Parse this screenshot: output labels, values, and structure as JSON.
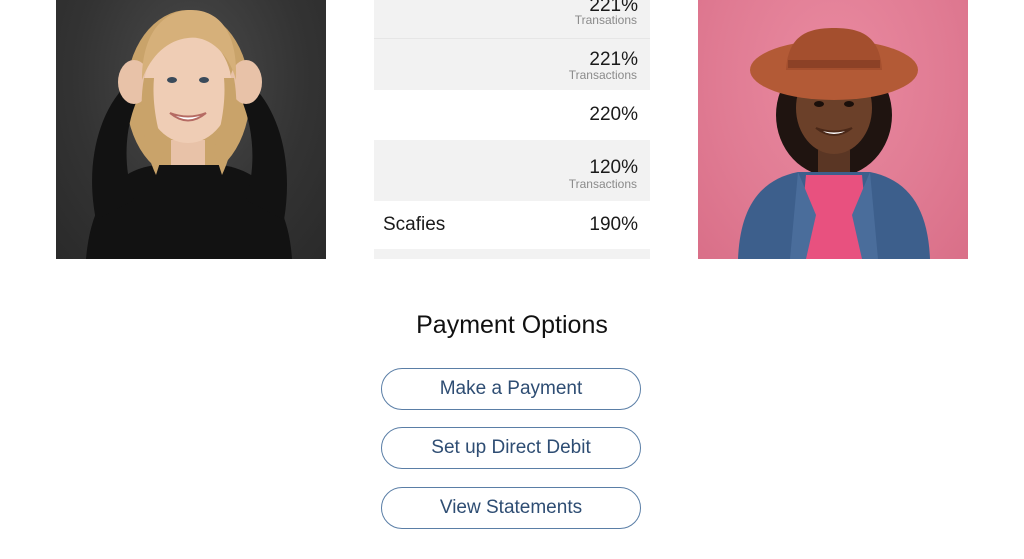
{
  "stats": [
    {
      "label": "",
      "value": "221%",
      "sub": "Transations"
    },
    {
      "label": "",
      "value": "221%",
      "sub": "Transactions"
    },
    {
      "label": "",
      "value": "220%",
      "sub": ""
    },
    {
      "label": "",
      "value": "120%",
      "sub": "Transactions"
    },
    {
      "label": "Scafies",
      "value": "190%",
      "sub": ""
    }
  ],
  "payment": {
    "title": "Payment Options",
    "buttons": [
      "Make a Payment",
      "Set up Direct Debit",
      "View Statements"
    ]
  },
  "colors": {
    "button_border": "#5a7ea6",
    "button_text": "#2e4d73",
    "row_shade": "#f2f2f2",
    "left_photo_bg": "#333333",
    "right_photo_bg": "#e07b93"
  }
}
